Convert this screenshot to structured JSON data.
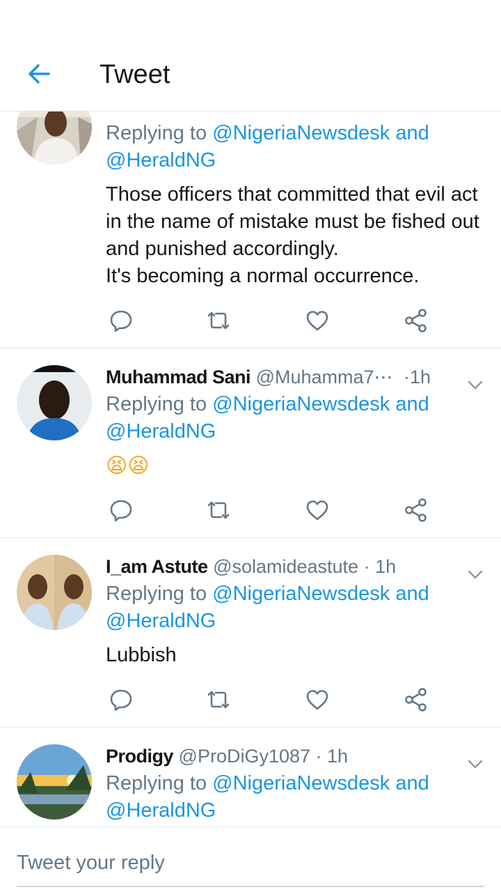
{
  "header": {
    "title": "Tweet"
  },
  "tweets": [
    {
      "replying_prefix": "Replying to",
      "mention_1": "@NigeriaNewsdesk",
      "and": "and",
      "mention_2": "@HeraldNG",
      "lines": [
        "Those officers that committed that evil act",
        "in the name of mistake must be fished out",
        "and punished accordingly.",
        "It's becoming a normal occurrence."
      ]
    },
    {
      "name": "Muhammad Sani",
      "handle": "@Muhamma7⋯",
      "time": "·1h",
      "replying_prefix": "Replying to",
      "mention_1": "@NigeriaNewsdesk",
      "and": "and",
      "mention_2": "@HeraldNG",
      "emoji": "😫😫"
    },
    {
      "name": "I_am Astute",
      "handle": "@solamideastute",
      "time": "· 1h",
      "replying_prefix": "Replying to",
      "mention_1": "@NigeriaNewsdesk",
      "and": "and",
      "mention_2": "@HeraldNG",
      "text": "Lubbish"
    },
    {
      "name": "Prodigy",
      "handle": "@ProDiGy1087",
      "time": "· 1h",
      "replying_prefix": "Replying to",
      "mention_1": "@NigeriaNewsdesk",
      "and": "and",
      "mention_2": "@HeraldNG"
    }
  ],
  "reply_bar": {
    "placeholder": "Tweet your reply"
  },
  "colors": {
    "accent": "#1b95e0",
    "muted": "#657786",
    "divider": "#e1e8ed",
    "icon": "#657786"
  },
  "icons": [
    "back-arrow-icon",
    "reply-icon",
    "retweet-icon",
    "like-icon",
    "share-icon",
    "chevron-down-icon"
  ]
}
